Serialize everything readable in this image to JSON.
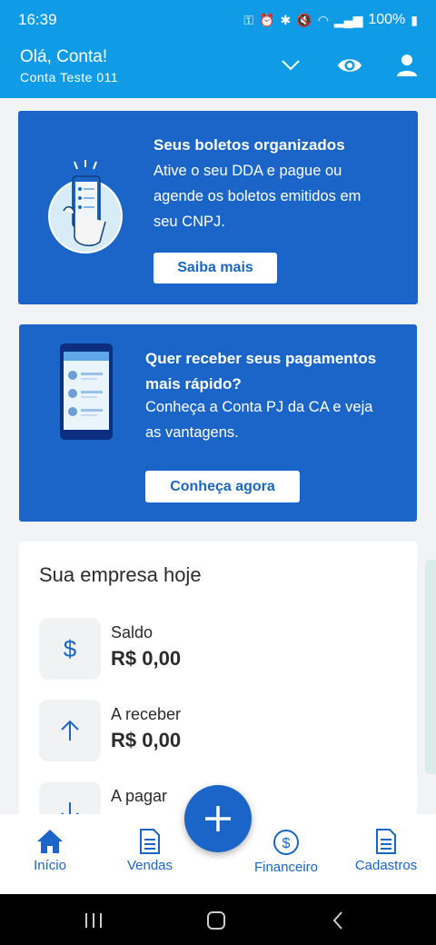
{
  "status": {
    "time": "16:39",
    "battery": "100%"
  },
  "header": {
    "greeting": "Olá, Conta!",
    "account": "Conta Teste 011"
  },
  "banner_dda": {
    "title": "Seus boletos organizados",
    "lines": [
      "Ative o seu DDA e pague ou",
      "agende os boletos emitidos em",
      "seu CNPJ."
    ],
    "button": "Saiba mais"
  },
  "banner_conta_pj": {
    "title_lines": [
      "Quer receber seus pagamentos",
      "mais rápido?"
    ],
    "lines": [
      "Conheça a Conta PJ da CA e veja",
      "as vantagens."
    ],
    "button": "Conheça agora"
  },
  "company": {
    "title": "Sua empresa hoje",
    "items": [
      {
        "label": "Saldo",
        "value": "R$ 0,00",
        "icon": "dollar-icon"
      },
      {
        "label": "A receber",
        "value": "R$ 0,00",
        "icon": "arrow-up-icon"
      },
      {
        "label": "A pagar",
        "value": "",
        "icon": "arrow-down-icon"
      }
    ]
  },
  "nav": {
    "items": [
      {
        "label": "Início",
        "icon": "home-icon",
        "active": true
      },
      {
        "label": "Vendas",
        "icon": "document-icon"
      },
      {
        "label": "Financeiro",
        "icon": "dollar-circle-icon"
      },
      {
        "label": "Cadastros",
        "icon": "document-icon"
      }
    ]
  },
  "colors": {
    "header": "#0f9be6",
    "primary": "#1a65c7",
    "background": "#f2f3f5"
  }
}
